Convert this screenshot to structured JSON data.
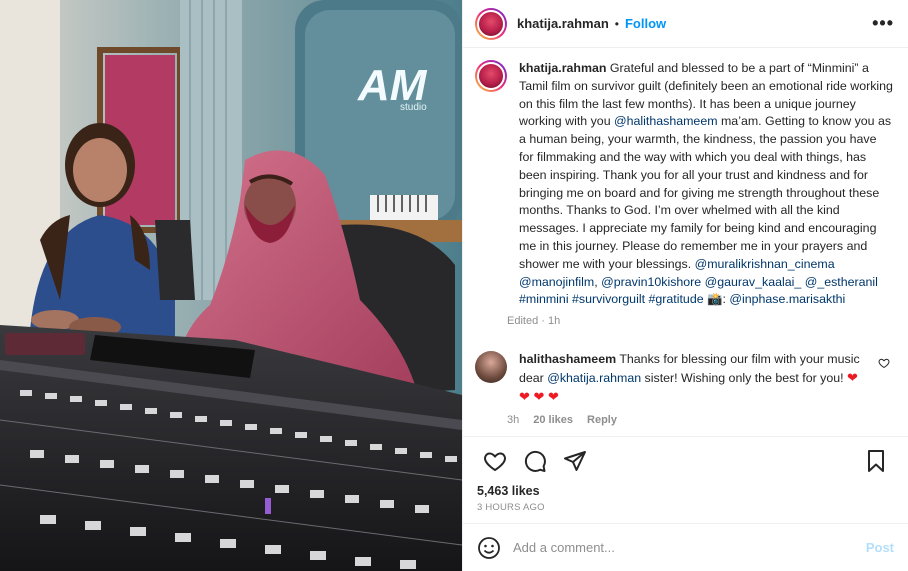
{
  "post": {
    "username": "khatija.rahman",
    "follow_label": "Follow",
    "more_label": "•••",
    "dot": "•"
  },
  "caption": {
    "username": "khatija.rahman",
    "text_1": " Grateful and blessed to be a part of “Minmini” a Tamil film on survivor guilt (definitely been an emotional ride working on this film the last few months). It has been a unique journey working with you ",
    "tag_1": "@halithashameem",
    "text_2": " ma’am. Getting to know you as a human being, your warmth, the kindness, the passion you have for filmmaking and the way with which you deal with things, has been inspiring. Thank you for all your trust and kindness and for bringing me on board and for giving me strength throughout these months. Thanks to God. I’m over whelmed with all the kind messages. I appreciate my family for being kind and encouraging me in this journey. Please do remember me in your prayers and shower me with your blessings. ",
    "tag_2": "@muralikrishnan_cinema",
    "tag_3": "@manojinfilm",
    "tag_4": "@pravin10kishore",
    "tag_5": "@gaurav_kaalai_",
    "tag_6": "@_estheranil",
    "tag_7": "#minmini",
    "tag_8": "#survivorguilt",
    "tag_9": "#gratitude",
    "camera_emoji": "📸",
    "colon": ": ",
    "tag_10": "@inphase.marisakthi",
    "edited": "Edited",
    "edited_time": "1h"
  },
  "comment": {
    "username": "halithashameem",
    "text_1": " Thanks for blessing our film with your music dear ",
    "tag": "@khatija.rahman",
    "text_2": " sister! Wishing only the best for you! ",
    "hearts_inline": "❤",
    "hearts_line": "❤ ❤ ❤",
    "time": "3h",
    "likes": "20 likes",
    "reply": "Reply"
  },
  "stats": {
    "likes": "5,463 likes",
    "time": "3 HOURS AGO"
  },
  "add_comment": {
    "placeholder": "Add a comment...",
    "post_label": "Post"
  },
  "photo": {
    "sign_text": "AM",
    "sign_sub": "studio"
  },
  "colors": {
    "accent": "#0095f6",
    "link": "#00376b",
    "heart": "#ed1c24",
    "post_disabled": "#b2dffc"
  }
}
